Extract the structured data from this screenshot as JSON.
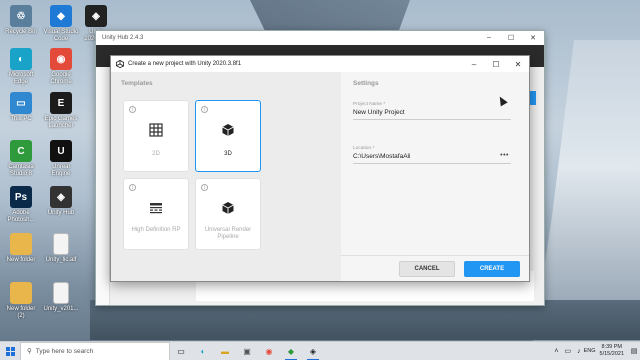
{
  "desktop": {
    "icons": [
      {
        "label": "Recycle Bin",
        "icon": "recycle-bin-icon",
        "color": "#5a7f9c"
      },
      {
        "label": "Visual Studio Code",
        "icon": "vscode-icon",
        "color": "#1f7ad6"
      },
      {
        "label": "Unity 2020.3...",
        "icon": "unity-icon",
        "color": "#222222"
      },
      {
        "label": "Microsoft Edge",
        "icon": "edge-icon",
        "color": "#1aa3c9"
      },
      {
        "label": "Google Chrome",
        "icon": "chrome-icon",
        "color": "#e44a3a"
      },
      {
        "label": "This PC",
        "icon": "monitor-icon",
        "color": "#2f88d0"
      },
      {
        "label": "Epic Games Launcher",
        "icon": "epic-icon",
        "color": "#1c1c1c"
      },
      {
        "label": "Camtasia Studio 8",
        "icon": "camtasia-icon",
        "color": "#2e9a3c"
      },
      {
        "label": "Unreal Engine",
        "icon": "unreal-icon",
        "color": "#111111"
      },
      {
        "label": "Adobe Photosh...",
        "icon": "photoshop-icon",
        "color": "#0b2a4a"
      },
      {
        "label": "Unity Hub",
        "icon": "unity-hub-icon",
        "color": "#333333"
      },
      {
        "label": "New folder",
        "icon": "folder-icon",
        "color": "#e8b64a"
      },
      {
        "label": "Unity_lic.alf",
        "icon": "file-icon",
        "color": "#f4f4f4"
      },
      {
        "label": "New folder (2)",
        "icon": "folder-icon",
        "color": "#e8b64a"
      },
      {
        "label": "Unity_v201...",
        "icon": "file-icon",
        "color": "#f4f4f4"
      }
    ]
  },
  "hub": {
    "title": "Unity Hub 2.4.3",
    "minimize": "–",
    "maximize": "☐",
    "close": "✕"
  },
  "dialog": {
    "title": "Create a new project with Unity 2020.3.8f1",
    "minimize": "–",
    "maximize": "☐",
    "close": "✕",
    "templates_heading": "Templates",
    "templates": [
      {
        "name": "2D",
        "icon": "grid-icon",
        "selected": false
      },
      {
        "name": "3D",
        "icon": "cube-icon",
        "selected": true
      },
      {
        "name": "High Definition RP",
        "icon": "hdrp-icon",
        "selected": false
      },
      {
        "name": "Universal Render Pipeline",
        "icon": "cube-icon",
        "selected": false
      }
    ],
    "settings_heading": "Settings",
    "project_name_label": "Project Name *",
    "project_name_value": "New Unity Project",
    "location_label": "Location *",
    "location_value": "C:\\Users\\MostafaAli",
    "browse_label": "•••",
    "cancel_label": "CANCEL",
    "create_label": "CREATE",
    "accent_color": "#2196f3"
  },
  "taskbar": {
    "search_placeholder": "Type here to search",
    "apps": [
      "task-view-icon",
      "edge-icon",
      "explorer-icon",
      "store-icon",
      "chrome-icon",
      "camtasia-icon",
      "unity-icon"
    ],
    "language": "ENG",
    "time": "8:39 PM",
    "date": "5/15/2021"
  }
}
